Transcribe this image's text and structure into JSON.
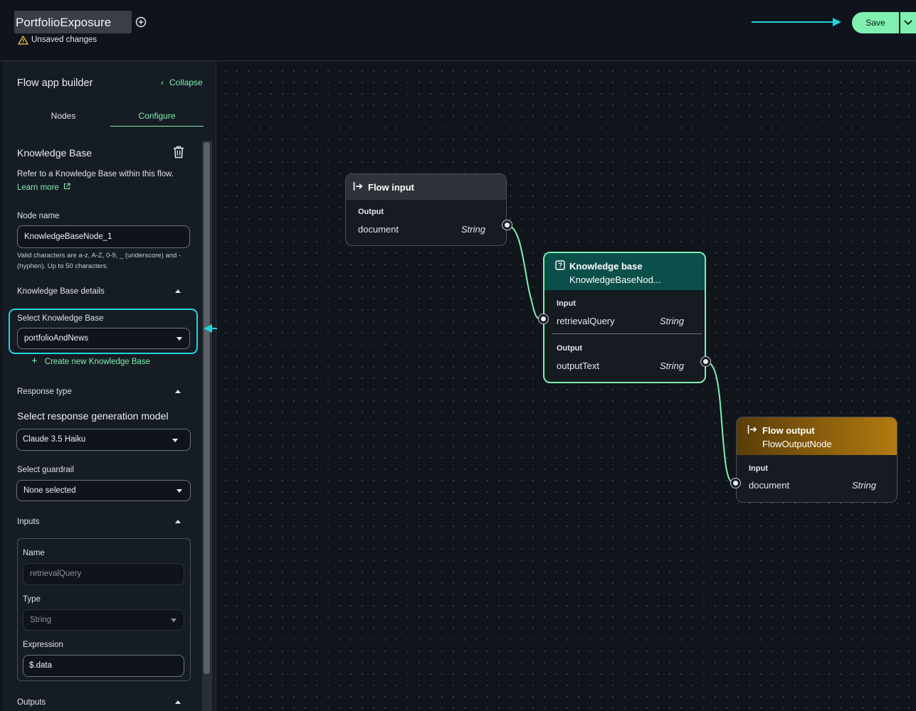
{
  "header": {
    "flow_name": "PortfolioExposure",
    "unsaved": "Unsaved changes",
    "save_label": "Save"
  },
  "sidebar": {
    "title": "Flow app builder",
    "collapse": "Collapse",
    "tabs": {
      "nodes": "Nodes",
      "configure": "Configure"
    },
    "section_title": "Knowledge Base",
    "description": "Refer to a Knowledge Base within this flow.",
    "learn_more": "Learn more",
    "node_name_label": "Node name",
    "node_name_value": "KnowledgeBaseNode_1",
    "node_name_hint": "Valid characters are a-z, A-Z, 0-9, _ (underscore) and - (hyphen). Up to 50 characters.",
    "kb_details": "Knowledge Base details",
    "select_kb_label": "Select Knowledge Base",
    "select_kb_value": "portfolioAndNews",
    "create_kb": "Create new Knowledge Base",
    "response_type": "Response type",
    "model_label": "Select response generation model",
    "model_value": "Claude 3.5 Haiku",
    "guardrail_label": "Select guardrail",
    "guardrail_value": "None selected",
    "inputs_title": "Inputs",
    "input_name_label": "Name",
    "input_name_value": "retrievalQuery",
    "input_type_label": "Type",
    "input_type_value": "String",
    "expression_label": "Expression",
    "expression_value": "$.data",
    "outputs_title": "Outputs"
  },
  "canvas": {
    "flow_input": {
      "title": "Flow input",
      "output_label": "Output",
      "field": "document",
      "type": "String"
    },
    "knowledge_base": {
      "title": "Knowledge base",
      "subtitle": "KnowledgeBaseNod...",
      "input_label": "Input",
      "input_field": "retrievalQuery",
      "input_type": "String",
      "output_label": "Output",
      "output_field": "outputText",
      "output_type": "String"
    },
    "flow_output": {
      "title": "Flow output",
      "subtitle": "FlowOutputNode",
      "input_label": "Input",
      "field": "document",
      "type": "String"
    }
  },
  "colors": {
    "accent": "#7ff0b0",
    "highlight": "#22d3dc",
    "kb_header": "#0b4f4a",
    "output_header": "#a06a0c"
  }
}
